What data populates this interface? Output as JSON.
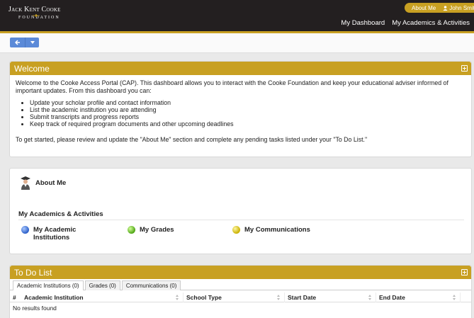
{
  "header": {
    "logo_line1": "Jack Kent Cooke",
    "logo_line2": "FOUNDATION",
    "top_links": {
      "about_me": "About Me",
      "user_name": "John Smith"
    },
    "nav": {
      "dashboard": "My Dashboard",
      "academics": "My Academics & Activities"
    }
  },
  "welcome": {
    "title": "Welcome",
    "intro": "Welcome to the Cooke Access Portal (CAP). This dashboard allows you to interact with the Cooke Foundation and keep your educational adviser informed of important updates. From this dashboard you can:",
    "bullets": [
      "Update your scholar profile and contact information",
      "List the academic institution you are attending",
      "Submit transcripts and progress reports",
      "Keep track of required program documents and other upcoming deadlines"
    ],
    "cta": "To get started, please review and update the \"About Me\" section and complete any pending tasks listed under your \"To Do List.\""
  },
  "dashboard": {
    "about_me": "About Me",
    "section_title": "My Academics & Activities",
    "links": [
      {
        "label": "My Academic Institutions",
        "color": "blue"
      },
      {
        "label": "My Grades",
        "color": "green"
      },
      {
        "label": "My Communications",
        "color": "yellow"
      }
    ]
  },
  "todo": {
    "title": "To Do List",
    "tabs": [
      "Academic Institutions (0)",
      "Grades (0)",
      "Communications (0)"
    ],
    "columns": [
      "#",
      "Academic Institution",
      "School Type",
      "Start Date",
      "End Date"
    ],
    "empty_text": "No results found"
  },
  "colors": {
    "gold": "#c8a022",
    "header_bg": "#231f20",
    "button_blue": "#5b8ad8"
  }
}
